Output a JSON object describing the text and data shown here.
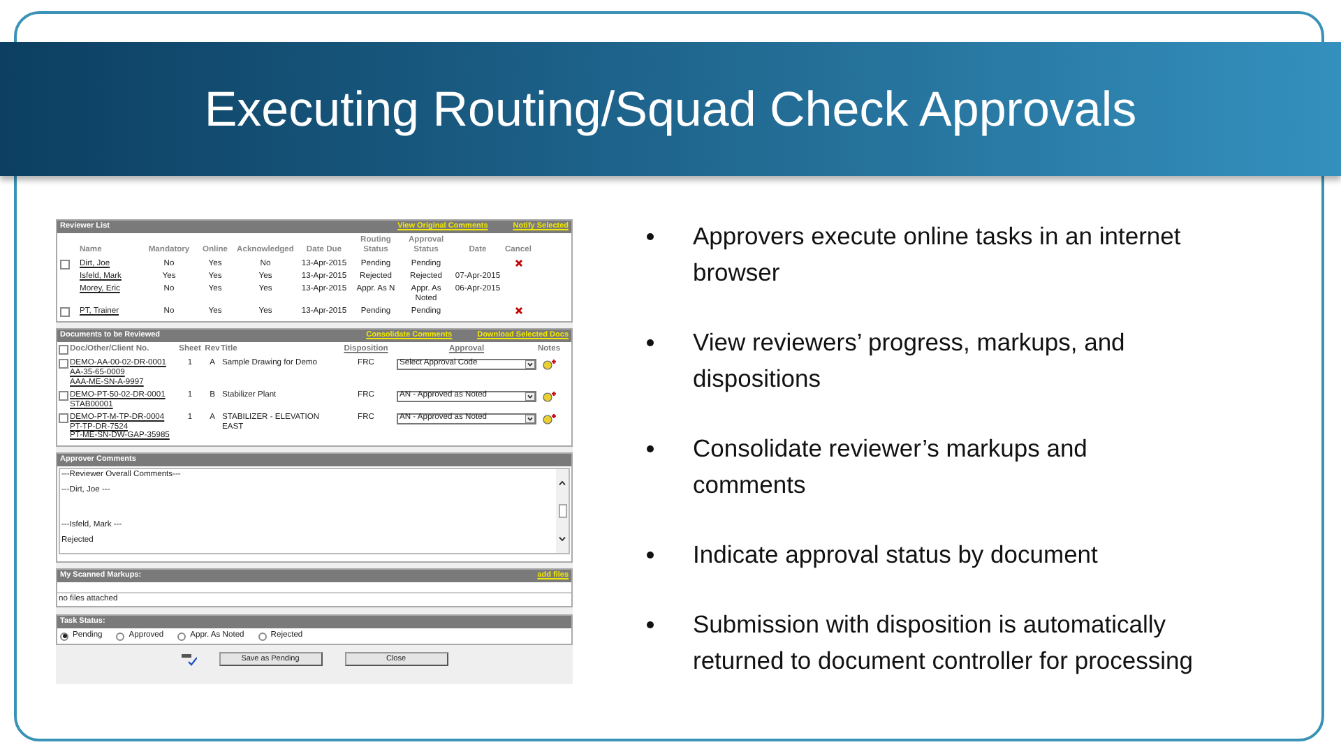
{
  "slide": {
    "title": "Executing Routing/Squad Check Approvals"
  },
  "reviewer_list": {
    "title": "Reviewer List",
    "links": [
      "View Original Comments",
      "Notify Selected"
    ],
    "columns": [
      "Name",
      "Mandatory",
      "Online",
      "Acknowledged",
      "Date Due",
      "Routing Status",
      "Approval Status",
      "Date",
      "Cancel"
    ],
    "rows": [
      {
        "selectable": true,
        "checked": false,
        "cancel": true,
        "cells": [
          "Dirt, Joe",
          "No",
          "Yes",
          "No",
          "13-Apr-2015",
          "Pending",
          "Pending",
          ""
        ]
      },
      {
        "selectable": false,
        "cancel": false,
        "cells": [
          "Isfeld, Mark",
          "Yes",
          "Yes",
          "Yes",
          "13-Apr-2015",
          "Rejected",
          "Rejected",
          "07-Apr-2015"
        ]
      },
      {
        "selectable": false,
        "cancel": false,
        "cells": [
          "Morey, Eric",
          "No",
          "Yes",
          "Yes",
          "13-Apr-2015",
          "Appr. As N",
          "Appr. As Noted",
          "06-Apr-2015"
        ]
      },
      {
        "selectable": true,
        "checked": false,
        "cancel": true,
        "cells": [
          "PT, Trainer",
          "No",
          "Yes",
          "Yes",
          "13-Apr-2015",
          "Pending",
          "Pending",
          ""
        ]
      }
    ]
  },
  "documents": {
    "title": "Documents to be Reviewed",
    "links": [
      "Consolidate Comments",
      "Download Selected Docs"
    ],
    "select_all_checked": false,
    "columns": [
      "Doc/Other/Client No.",
      "Sheet",
      "Rev",
      "Title",
      "Disposition",
      "Approval",
      "Notes"
    ],
    "rows": [
      {
        "checked": false,
        "numbers": [
          "DEMO-AA-00-02-DR-0001",
          "AA-35-65-0009",
          "AAA-ME-SN-A-9997"
        ],
        "sheet": "1",
        "rev": "A",
        "title": "Sample Drawing for Demo",
        "disposition": "FRC",
        "approval": "Select Approval Code"
      },
      {
        "checked": false,
        "numbers": [
          "DEMO-PT-50-02-DR-0001",
          "STAB00001"
        ],
        "sheet": "1",
        "rev": "B",
        "title": "Stabilizer Plant",
        "disposition": "FRC",
        "approval": "AN - Approved as Noted"
      },
      {
        "checked": false,
        "numbers": [
          "DEMO-PT-M-TP-DR-0004",
          "PT-TP-DR-7524",
          "PT-ME-SN-DW-GAP-35985"
        ],
        "sheet": "1",
        "rev": "A",
        "title": "STABILIZER - ELEVATION EAST",
        "disposition": "FRC",
        "approval": "AN - Approved as Noted"
      }
    ]
  },
  "approver_comments": {
    "title": "Approver Comments",
    "blocks": [
      [
        "---Reviewer Overall Comments---",
        "---Dirt, Joe ---"
      ],
      [
        "---Isfeld, Mark ---",
        "Rejected"
      ]
    ]
  },
  "scanned_markups": {
    "title": "My Scanned Markups:",
    "link": "add files",
    "message": "no files attached"
  },
  "task_status": {
    "title": "Task Status:",
    "options": [
      {
        "label": "Pending",
        "selected": true
      },
      {
        "label": "Approved",
        "selected": false
      },
      {
        "label": "Appr. As Noted",
        "selected": false
      },
      {
        "label": "Rejected",
        "selected": false
      }
    ]
  },
  "buttons": [
    "Save as Pending",
    "Close"
  ],
  "bullets": [
    "Approvers execute online tasks in an internet browser",
    "View reviewers’ progress, markups, and dispositions",
    "Consolidate reviewer’s markups and comments",
    "Indicate approval status by document",
    "Submission with disposition is automatically returned to document controller for processing"
  ]
}
